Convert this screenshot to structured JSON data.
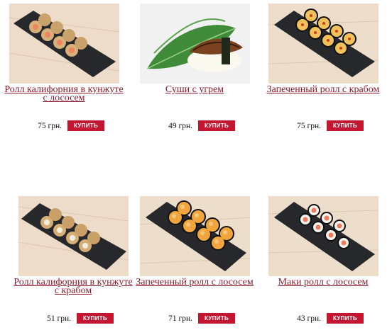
{
  "products": [
    {
      "name": "Ролл калифорния в кунжуте с лососем",
      "price": "75 грн.",
      "buy_label": "КУПИТЬ",
      "photo": "sesame-salmon-roll"
    },
    {
      "name": "Суши с угрем",
      "price": "49 грн.",
      "buy_label": "КУПИТЬ",
      "photo": "eel-nigiri"
    },
    {
      "name": "Запеченный ролл с крабом",
      "price": "75 грн.",
      "buy_label": "КУПИТЬ",
      "photo": "baked-crab-roll"
    },
    {
      "name": "Ролл калифорния в кунжуте с крабом",
      "price": "51 грн.",
      "buy_label": "КУПИТЬ",
      "photo": "sesame-crab-roll"
    },
    {
      "name": "Запеченный ролл с лососем",
      "price": "71 грн.",
      "buy_label": "КУПИТЬ",
      "photo": "baked-salmon-roll"
    },
    {
      "name": "Маки ролл с лососем",
      "price": "43 грн.",
      "buy_label": "КУПИТЬ",
      "photo": "salmon-maki"
    }
  ],
  "colors": {
    "title": "#8e1b2b",
    "button": "#c41631"
  }
}
